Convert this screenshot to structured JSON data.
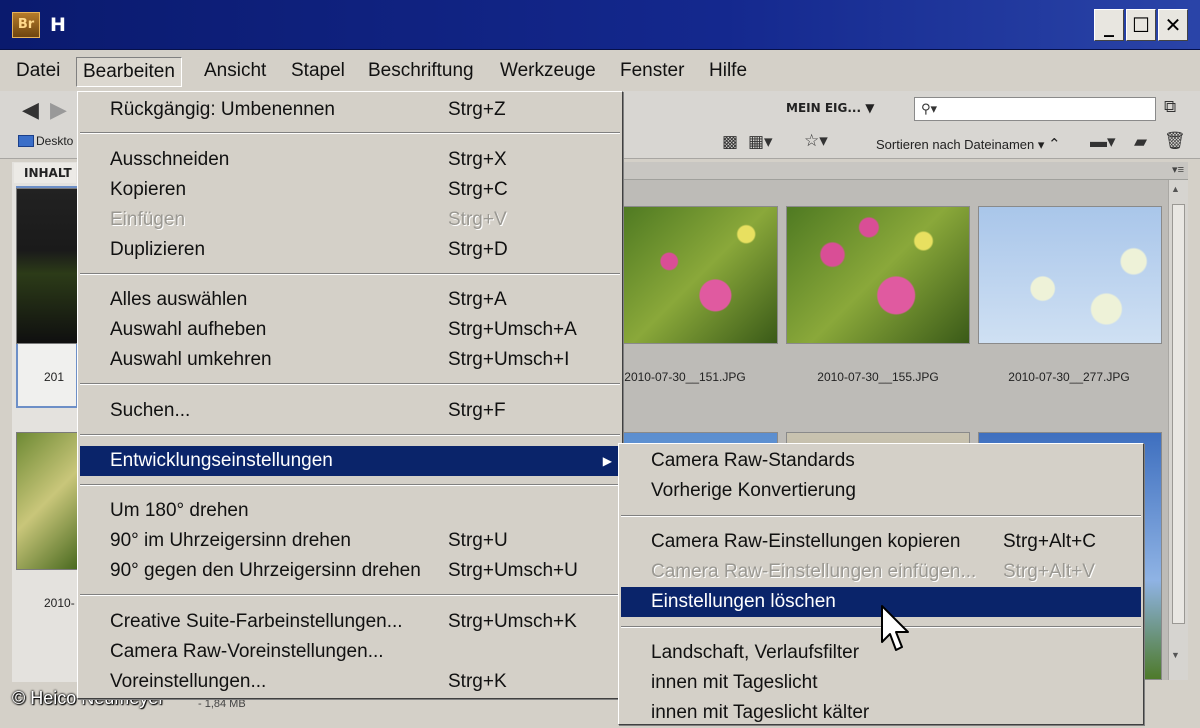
{
  "window": {
    "app_icon": "Br",
    "title": "H",
    "buttons": {
      "minimize": "_",
      "maximize": "☐",
      "close": "✕"
    }
  },
  "menubar": {
    "items": [
      "Datei",
      "Bearbeiten",
      "Ansicht",
      "Stapel",
      "Beschriftung",
      "Werkzeuge",
      "Fenster",
      "Hilfe"
    ],
    "active": "Bearbeiten"
  },
  "toolbar": {
    "workspace_label": "MEIN EIG...",
    "search_placeholder": "",
    "sort_label": "Sortieren nach Dateinamen",
    "favorite_label": "Deskto"
  },
  "panels": {
    "content_tab": "INHALT"
  },
  "thumbnails": [
    {
      "label": "2010-07-30__151.JPG",
      "kind": "pink-flower"
    },
    {
      "label": "2010-07-30__155.JPG",
      "kind": "pink-flower"
    },
    {
      "label": "2010-07-30__277.JPG",
      "kind": "white-umbel"
    }
  ],
  "left_thumbnails": [
    {
      "label": "201"
    },
    {
      "label": "2010-"
    }
  ],
  "status": {
    "text": "- 1,84 MB"
  },
  "copyright": "© Heico Neumeyer",
  "edit_menu": {
    "items": [
      {
        "label": "Rückgängig: Umbenennen",
        "shortcut": "Strg+Z"
      },
      {
        "label": "Ausschneiden",
        "shortcut": "Strg+X"
      },
      {
        "label": "Kopieren",
        "shortcut": "Strg+C"
      },
      {
        "label": "Einfügen",
        "shortcut": "Strg+V"
      },
      {
        "label": "Duplizieren",
        "shortcut": "Strg+D"
      },
      {
        "label": "Alles auswählen",
        "shortcut": "Strg+A"
      },
      {
        "label": "Auswahl aufheben",
        "shortcut": "Strg+Umsch+A"
      },
      {
        "label": "Auswahl umkehren",
        "shortcut": "Strg+Umsch+I"
      },
      {
        "label": "Suchen...",
        "shortcut": "Strg+F"
      },
      {
        "label": "Entwicklungseinstellungen",
        "shortcut": ""
      },
      {
        "label": "Um 180° drehen",
        "shortcut": ""
      },
      {
        "label": "90° im Uhrzeigersinn drehen",
        "shortcut": "Strg+U"
      },
      {
        "label": "90° gegen den Uhrzeigersinn drehen",
        "shortcut": "Strg+Umsch+U"
      },
      {
        "label": "Creative Suite-Farbeinstellungen...",
        "shortcut": "Strg+Umsch+K"
      },
      {
        "label": "Camera Raw-Voreinstellungen...",
        "shortcut": ""
      },
      {
        "label": "Voreinstellungen...",
        "shortcut": "Strg+K"
      }
    ]
  },
  "submenu": {
    "items": [
      {
        "label": "Camera Raw-Standards",
        "shortcut": ""
      },
      {
        "label": "Vorherige Konvertierung",
        "shortcut": ""
      },
      {
        "label": "Camera Raw-Einstellungen kopieren",
        "shortcut": "Strg+Alt+C"
      },
      {
        "label": "Camera Raw-Einstellungen einfügen...",
        "shortcut": "Strg+Alt+V"
      },
      {
        "label": "Einstellungen löschen",
        "shortcut": ""
      },
      {
        "label": "Landschaft, Verlaufsfilter",
        "shortcut": ""
      },
      {
        "label": "innen mit Tageslicht",
        "shortcut": ""
      },
      {
        "label": "innen mit Tageslicht kälter",
        "shortcut": ""
      }
    ]
  }
}
